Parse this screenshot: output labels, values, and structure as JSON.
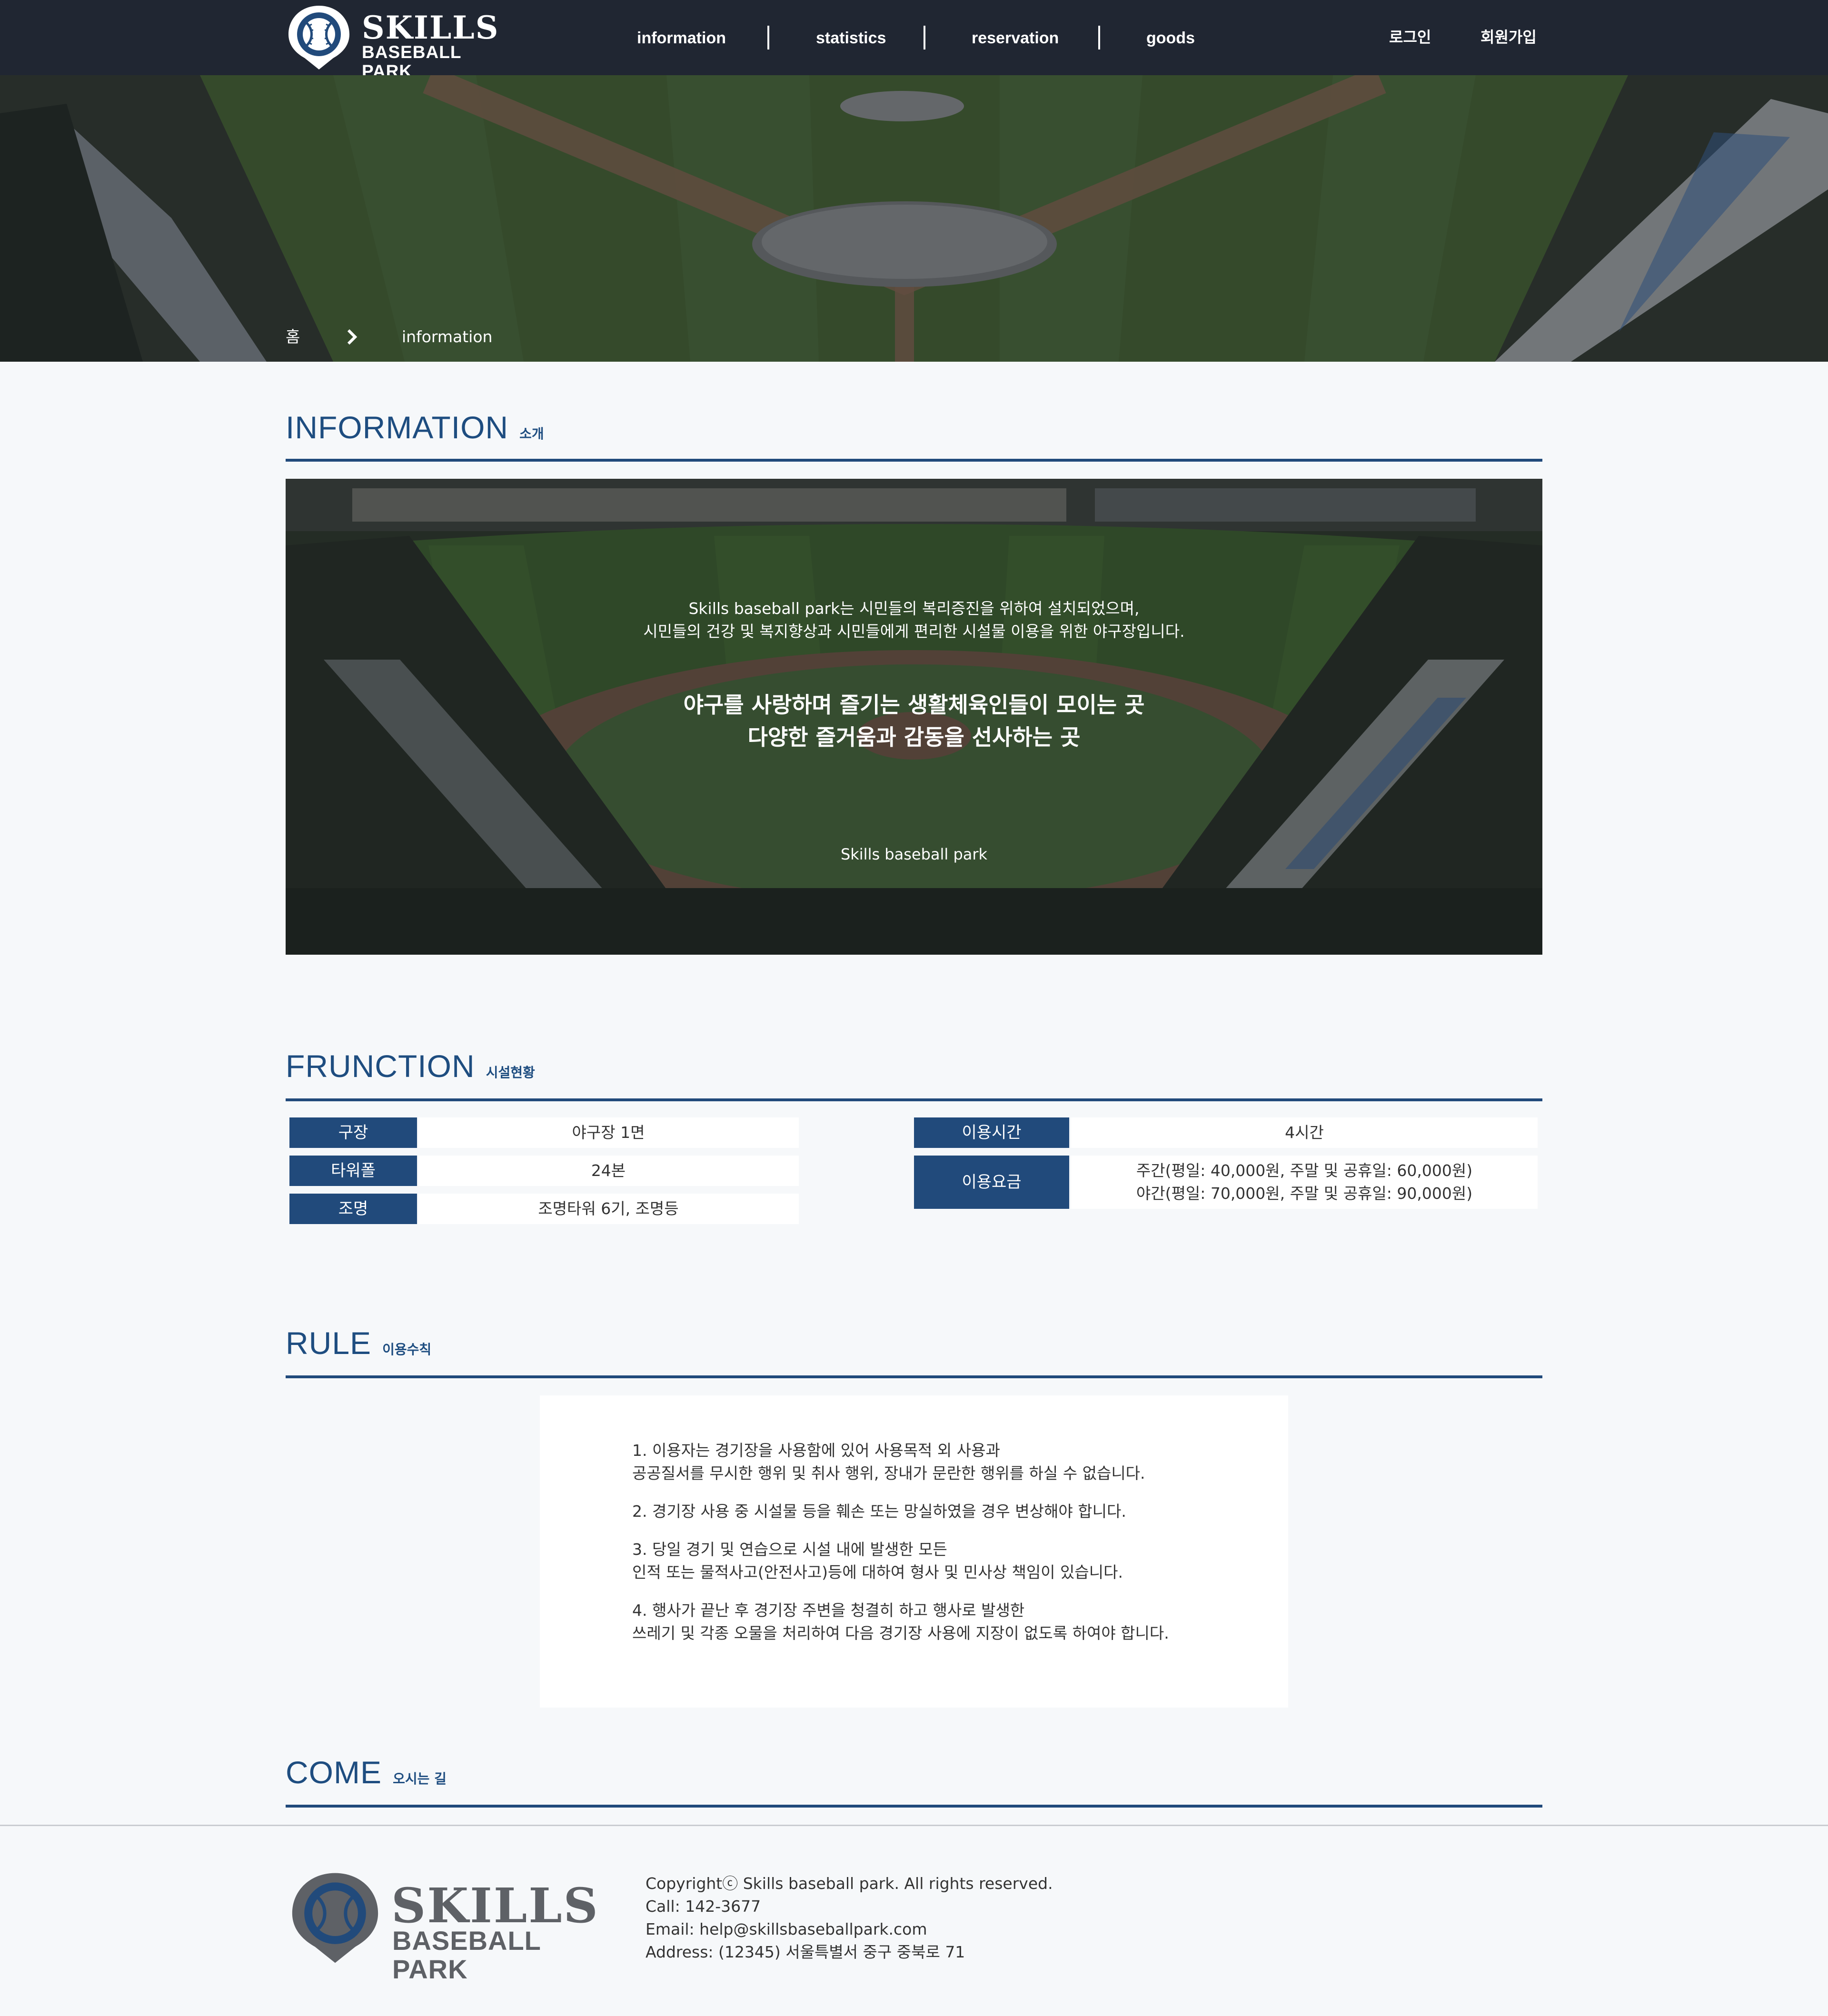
{
  "brand": {
    "name": "SKILLS",
    "subtitle": "BASEBALL PARK",
    "primary_color": "#214a7b",
    "header_bg": "#202632"
  },
  "nav": {
    "items": [
      {
        "label": "information"
      },
      {
        "label": "statistics"
      },
      {
        "label": "reservation"
      },
      {
        "label": "goods"
      }
    ],
    "login": "로그인",
    "signup": "회원가입"
  },
  "breadcrumb": {
    "home": "홈",
    "current": "information"
  },
  "information": {
    "title": "INFORMATION",
    "subtitle": "소개",
    "lead_lines": [
      "Skills baseball park는 시민들의 복리증진을 위하여 설치되었으며,",
      "시민들의 건강 및 복지향상과 시민들에게 편리한 시설물 이용을 위한 야구장입니다."
    ],
    "slogan_lines": [
      "야구를 사랑하며 즐기는 생활체육인들이 모이는 곳",
      "다양한 즐거움과 감동을 선사하는 곳"
    ],
    "caption": "Skills baseball park"
  },
  "facility": {
    "title": "FRUNCTION",
    "subtitle": "시설현황",
    "left": [
      {
        "label": "구장",
        "value": "야구장 1면"
      },
      {
        "label": "타워폴",
        "value": "24본"
      },
      {
        "label": "조명",
        "value": "조명타워 6기, 조명등"
      }
    ],
    "right": [
      {
        "label": "이용시간",
        "value": "4시간"
      },
      {
        "label": "이용요금",
        "values": [
          "주간(평일: 40,000원, 주말 및 공휴일: 60,000원)",
          "야간(평일: 70,000원, 주말 및 공휴일: 90,000원)"
        ]
      }
    ]
  },
  "rules": {
    "title": "RULE",
    "subtitle": "이용수칙",
    "items": [
      [
        "1. 이용자는 경기장을 사용함에 있어 사용목적 외 사용과",
        "공공질서를 무시한 행위 및 취사 행위, 장내가 문란한 행위를 하실 수 없습니다."
      ],
      [
        "2. 경기장 사용 중 시설물 등을 훼손 또는 망실하였을 경우 변상해야 합니다."
      ],
      [
        "3. 당일 경기 및 연습으로 시설 내에 발생한 모든",
        "인적 또는 물적사고(안전사고)등에 대하여 형사 및 민사상 책임이 있습니다."
      ],
      [
        "4. 행사가 끝난 후 경기장 주변을 청결히 하고 행사로 발생한",
        "쓰레기 및 각종 오물을 처리하여 다음 경기장 사용에 지장이 없도록 하여야 합니다."
      ]
    ]
  },
  "come": {
    "title": "COME",
    "subtitle": "오시는 길"
  },
  "footer": {
    "logo_name": "SKILLS",
    "logo_subtitle": "BASEBALL PARK",
    "copyright": "Copyrightⓒ Skills baseball park. All rights reserved.",
    "call": "Call: 142-3677",
    "email": "Email: help@skillsbaseballpark.com",
    "address": "Address: (12345) 서울특별서 중구 중북로 71"
  }
}
